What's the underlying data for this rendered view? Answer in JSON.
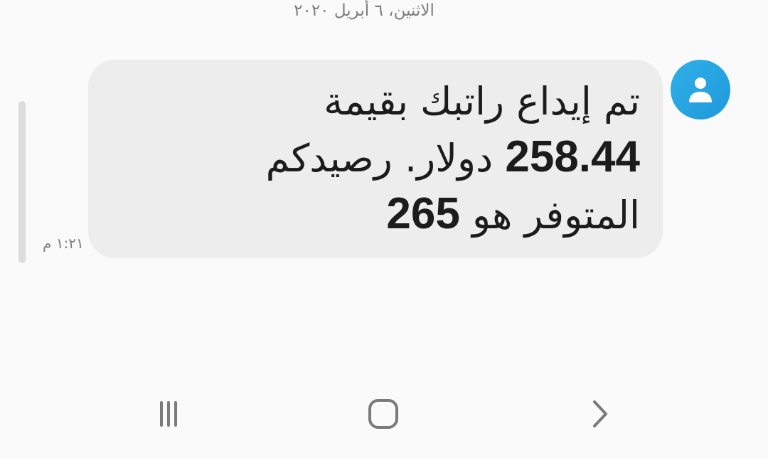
{
  "date_header": "الاثنين، ٦ أبريل ٢٠٢٠",
  "message": {
    "line1": "تم إيداع راتبك بقيمة",
    "line2_amount": "258.44",
    "line2_text": " دولار. رصيدكم",
    "line3_text": "المتوفر هو ",
    "line3_balance": "265",
    "time": "١:٢١ م"
  },
  "sender": {
    "icon": "person-icon",
    "avatar_color": "#2aa8e4"
  },
  "nav": {
    "recents_icon": "recents-icon",
    "home_icon": "home-icon",
    "back_icon": "back-icon"
  }
}
